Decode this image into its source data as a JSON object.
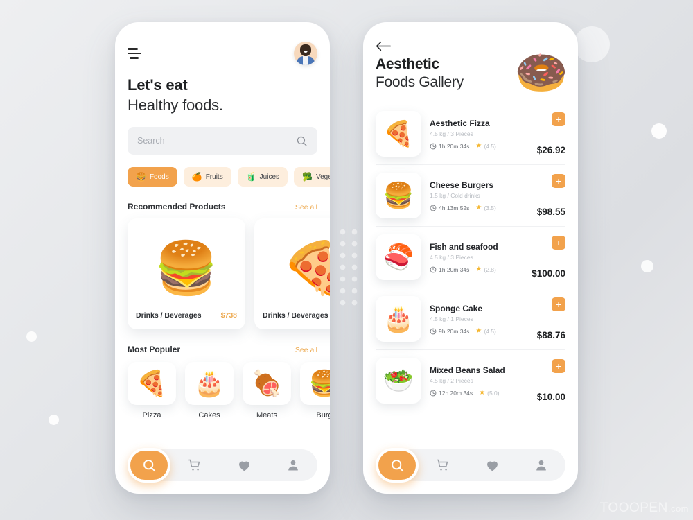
{
  "background": {
    "watermark_main": "TOOOPEN",
    "watermark_suffix": ".com"
  },
  "accent": {
    "orange": "#f2a24c",
    "orange_text": "#eda94f",
    "muted": "#b8bcc2"
  },
  "home": {
    "menu_icon": "hamburger-menu-icon",
    "avatar_icon": "user-avatar",
    "headline_line1": "Let's eat",
    "headline_line2": "Healthy foods.",
    "search": {
      "placeholder": "Search",
      "icon": "search-icon"
    },
    "chips": [
      {
        "label": "Foods",
        "emoji": "🍔",
        "active": true
      },
      {
        "label": "Fruits",
        "emoji": "🍊",
        "active": false
      },
      {
        "label": "Juices",
        "emoji": "🧃",
        "active": false
      },
      {
        "label": "Veget",
        "emoji": "🥦",
        "active": false
      }
    ],
    "recommended": {
      "title": "Recommended Products",
      "see_all": "See all",
      "cards": [
        {
          "name": "Drinks / Beverages",
          "price": "$738",
          "emoji": "🍔"
        },
        {
          "name": "Drinks / Beverages",
          "price": "",
          "emoji": "🍕"
        }
      ]
    },
    "popular": {
      "title": "Most Populer",
      "see_all": "See all",
      "items": [
        {
          "label": "Pizza",
          "emoji": "🍕"
        },
        {
          "label": "Cakes",
          "emoji": "🎂"
        },
        {
          "label": "Meats",
          "emoji": "🍖"
        },
        {
          "label": "Burg",
          "emoji": "🍔"
        }
      ]
    },
    "nav": [
      {
        "icon": "search-icon",
        "active": true
      },
      {
        "icon": "cart-icon",
        "active": false
      },
      {
        "icon": "heart-icon",
        "active": false
      },
      {
        "icon": "profile-icon",
        "active": false
      }
    ]
  },
  "gallery": {
    "back_icon": "back-arrow-icon",
    "title_line1": "Aesthetic",
    "title_line2": "Foods Gallery",
    "hero_emoji": "🍩",
    "add_label": "+",
    "items": [
      {
        "name": "Aesthetic Fizza",
        "sub": "4.5 kg / 3 Pieces",
        "time": "1h 20m 34s",
        "rating": "(4.5)",
        "price": "$26.92",
        "emoji": "🍕"
      },
      {
        "name": "Cheese Burgers",
        "sub": "1.5 kg / Cold drinks",
        "time": "4h 13m 52s",
        "rating": "(3.5)",
        "price": "$98.55",
        "emoji": "🍔"
      },
      {
        "name": "Fish and seafood",
        "sub": "4.5 kg / 3 Pieces",
        "time": "1h 20m 34s",
        "rating": "(2.8)",
        "price": "$100.00",
        "emoji": "🍣"
      },
      {
        "name": "Sponge Cake",
        "sub": "4.5 kg / 1 Pieces",
        "time": "9h 20m 34s",
        "rating": "(4.5)",
        "price": "$88.76",
        "emoji": "🎂"
      },
      {
        "name": "Mixed Beans Salad",
        "sub": "4.5 kg / 2 Pieces",
        "time": "12h 20m 34s",
        "rating": "(5.0)",
        "price": "$10.00",
        "emoji": "🥗"
      }
    ],
    "nav": [
      {
        "icon": "search-icon",
        "active": true
      },
      {
        "icon": "cart-icon",
        "active": false
      },
      {
        "icon": "heart-icon",
        "active": false
      },
      {
        "icon": "profile-icon",
        "active": false
      }
    ]
  }
}
